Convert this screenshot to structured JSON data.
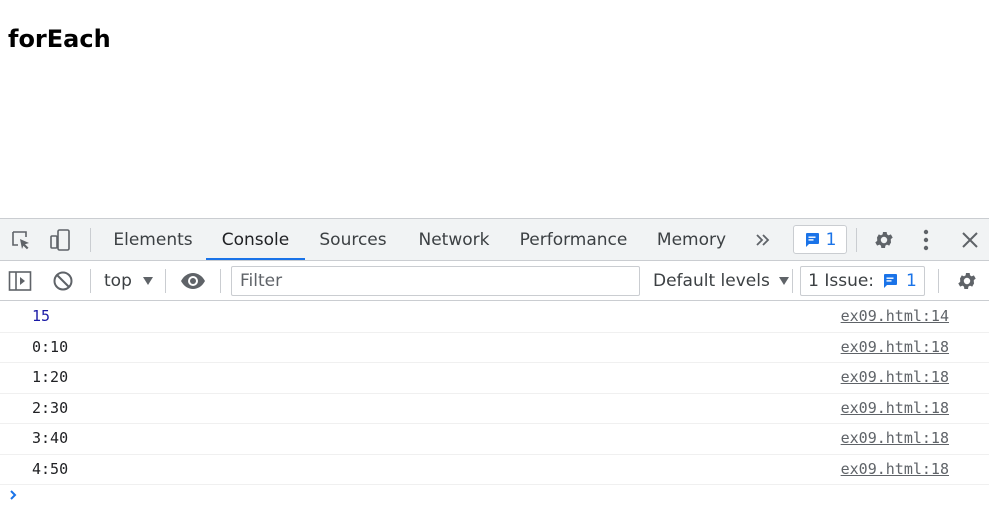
{
  "page": {
    "heading": "forEach"
  },
  "devtools": {
    "tabs": [
      {
        "label": "Elements"
      },
      {
        "label": "Console"
      },
      {
        "label": "Sources"
      },
      {
        "label": "Network"
      },
      {
        "label": "Performance"
      },
      {
        "label": "Memory"
      }
    ],
    "active_tab": "Console",
    "issues_badge_count": "1",
    "console_toolbar": {
      "context": "top",
      "filter_placeholder": "Filter",
      "levels": "Default levels",
      "issue_label": "1 Issue:",
      "issue_count": "1"
    },
    "messages": [
      {
        "text": "15",
        "source": "ex09.html:14",
        "kind": "number"
      },
      {
        "text": "0:10",
        "source": "ex09.html:18",
        "kind": "string"
      },
      {
        "text": "1:20",
        "source": "ex09.html:18",
        "kind": "string"
      },
      {
        "text": "2:30",
        "source": "ex09.html:18",
        "kind": "string"
      },
      {
        "text": "3:40",
        "source": "ex09.html:18",
        "kind": "string"
      },
      {
        "text": "4:50",
        "source": "ex09.html:18",
        "kind": "string"
      }
    ],
    "colors": {
      "accent": "#1a73e8",
      "number": "#1a1aa6",
      "border": "#cacdd1",
      "toolbar_bg": "#f1f3f4"
    }
  }
}
